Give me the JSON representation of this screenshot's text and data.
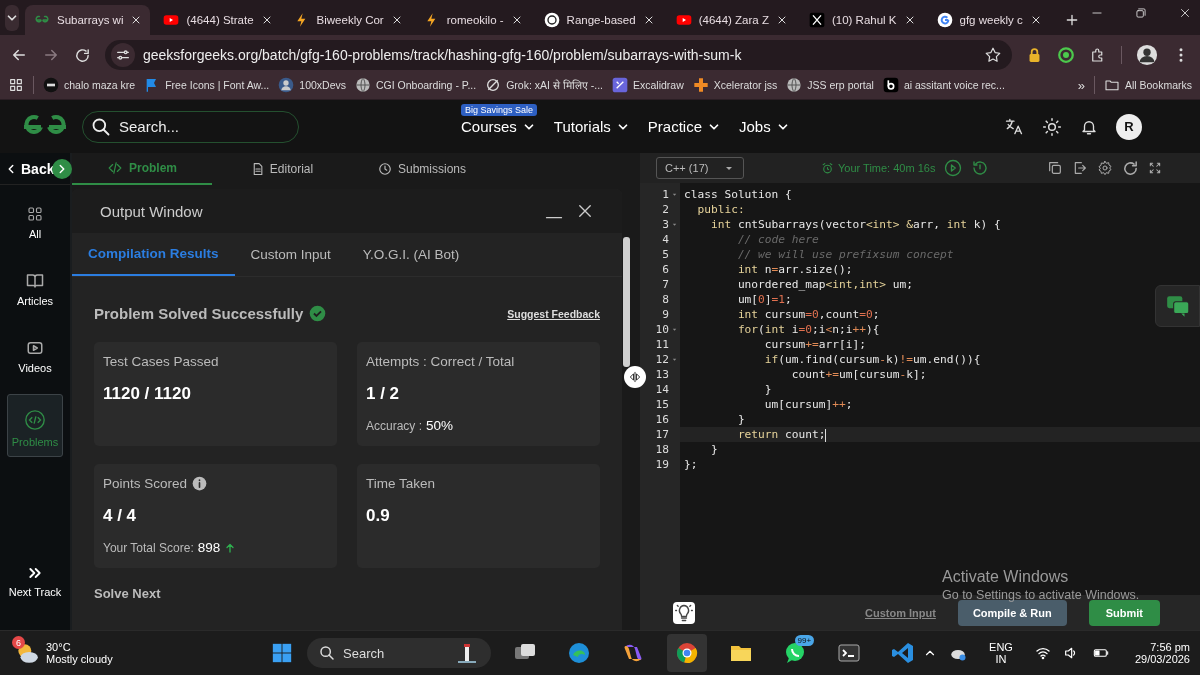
{
  "browser": {
    "tabs": [
      {
        "kind": "gfg",
        "label": "Subarrays wi",
        "selected": true
      },
      {
        "kind": "youtube",
        "label": "(4644) Strate",
        "selected": false
      },
      {
        "kind": "bolt",
        "label": "Biweekly Cor",
        "selected": false
      },
      {
        "kind": "bolt",
        "label": "romeokilo -",
        "selected": false
      },
      {
        "kind": "openai",
        "label": "Range-based",
        "selected": false
      },
      {
        "kind": "youtube",
        "label": "(4644) Zara Z",
        "selected": false
      },
      {
        "kind": "x",
        "label": "(10) Rahul K",
        "selected": false
      },
      {
        "kind": "google",
        "label": "gfg weekly c",
        "selected": false
      }
    ],
    "url": "geeksforgeeks.org/batch/gfg-160-problems/track/hashing-gfg-160/problem/subarrays-with-sum-k",
    "bookmarks": [
      {
        "kind": "tuf",
        "label": "chalo maza kre"
      },
      {
        "kind": "flag",
        "label": "Free Icons | Font Aw..."
      },
      {
        "kind": "avatar",
        "label": "100xDevs"
      },
      {
        "kind": "globe",
        "label": "CGI Onboarding - P..."
      },
      {
        "kind": "grok",
        "label": "Grok: xAI से मिलिए -..."
      },
      {
        "kind": "excalidraw",
        "label": "Excalidraw"
      },
      {
        "kind": "xcelerator",
        "label": "Xcelerator jss"
      },
      {
        "kind": "globe",
        "label": "JSS erp portal"
      },
      {
        "kind": "b",
        "label": "ai assitant voice rec..."
      }
    ],
    "more": "»",
    "all_bookmarks": "All Bookmarks"
  },
  "header": {
    "search_placeholder": "Search...",
    "promo": "Big Savings Sale",
    "nav": [
      "Courses",
      "Tutorials",
      "Practice",
      "Jobs"
    ],
    "avatar": "R"
  },
  "sidebar": {
    "back": "Back",
    "items": [
      {
        "kind": "grid",
        "label": "All",
        "selected": false
      },
      {
        "kind": "book",
        "label": "Articles",
        "selected": false
      },
      {
        "kind": "video",
        "label": "Videos",
        "selected": false
      },
      {
        "kind": "code",
        "label": "Problems",
        "selected": true
      }
    ],
    "next": "Next Track"
  },
  "problem_tabs": [
    {
      "kind": "code",
      "label": "Problem",
      "selected": true
    },
    {
      "kind": "doc",
      "label": "Editorial",
      "selected": false
    },
    {
      "kind": "clock",
      "label": "Submissions",
      "selected": false
    }
  ],
  "output": {
    "title": "Output Window",
    "tabs": [
      {
        "label": "Compilation Results",
        "selected": true
      },
      {
        "label": "Custom Input",
        "selected": false
      },
      {
        "label": "Y.O.G.I. (AI Bot)",
        "selected": false
      }
    ],
    "status": "Problem Solved Successfully",
    "feedback": "Suggest Feedback",
    "cards": [
      {
        "label": "Test Cases Passed",
        "value": "1120 / 1120"
      },
      {
        "label": "Attempts : Correct / Total",
        "value": "1 / 2",
        "note_label": "Accuracy :",
        "note_value": "50%"
      },
      {
        "label": "Points Scored",
        "info": true,
        "value": "4 / 4",
        "note_label": "Your Total Score:",
        "note_value": "898",
        "rising": true
      },
      {
        "label": "Time Taken",
        "value": "0.9"
      }
    ],
    "solve_next": "Solve Next"
  },
  "editor": {
    "language": "C++ (17)",
    "timer": "Your Time: 40m 16s",
    "lines": [
      {
        "n": "1",
        "fold": true,
        "current": false,
        "tokens": [
          {
            "text": "class Solution {",
            "kind": "plain"
          }
        ]
      },
      {
        "n": "2",
        "fold": false,
        "current": false,
        "tokens": [
          {
            "text": "  public:",
            "kind": "keyword"
          }
        ]
      },
      {
        "n": "3",
        "fold": true,
        "current": false,
        "tokens": [
          {
            "text": "    int",
            "kind": "keyword"
          },
          {
            "text": " cntSubarrays(vector",
            "kind": "plain"
          },
          {
            "text": "<int> &",
            "kind": "keyword"
          },
          {
            "text": "arr, ",
            "kind": "plain"
          },
          {
            "text": "int",
            "kind": "keyword"
          },
          {
            "text": " k) {",
            "kind": "plain"
          }
        ]
      },
      {
        "n": "4",
        "fold": false,
        "current": false,
        "tokens": [
          {
            "text": "        // code here",
            "kind": "comment"
          }
        ]
      },
      {
        "n": "5",
        "fold": false,
        "current": false,
        "tokens": [
          {
            "text": "        // we will use prefixsum concept",
            "kind": "comment"
          }
        ]
      },
      {
        "n": "6",
        "fold": false,
        "current": false,
        "tokens": [
          {
            "text": "        int",
            "kind": "keyword"
          },
          {
            "text": " n",
            "kind": "plain"
          },
          {
            "text": "=",
            "kind": "operator"
          },
          {
            "text": "arr.size();",
            "kind": "plain"
          }
        ]
      },
      {
        "n": "7",
        "fold": false,
        "current": false,
        "tokens": [
          {
            "text": "        unordered_map",
            "kind": "plain"
          },
          {
            "text": "<int,int>",
            "kind": "keyword"
          },
          {
            "text": " um;",
            "kind": "plain"
          }
        ]
      },
      {
        "n": "8",
        "fold": false,
        "current": false,
        "tokens": [
          {
            "text": "        um[",
            "kind": "plain"
          },
          {
            "text": "0",
            "kind": "number"
          },
          {
            "text": "]",
            "kind": "plain"
          },
          {
            "text": "=1",
            "kind": "number"
          },
          {
            "text": ";",
            "kind": "plain"
          }
        ]
      },
      {
        "n": "9",
        "fold": false,
        "current": false,
        "tokens": [
          {
            "text": "        int",
            "kind": "keyword"
          },
          {
            "text": " cursum",
            "kind": "plain"
          },
          {
            "text": "=0",
            "kind": "number"
          },
          {
            "text": ",count",
            "kind": "plain"
          },
          {
            "text": "=0",
            "kind": "number"
          },
          {
            "text": ";",
            "kind": "plain"
          }
        ]
      },
      {
        "n": "10",
        "fold": true,
        "current": false,
        "tokens": [
          {
            "text": "        for",
            "kind": "keyword"
          },
          {
            "text": "(",
            "kind": "plain"
          },
          {
            "text": "int",
            "kind": "keyword"
          },
          {
            "text": " i",
            "kind": "plain"
          },
          {
            "text": "=0",
            "kind": "number"
          },
          {
            "text": ";i",
            "kind": "plain"
          },
          {
            "text": "<",
            "kind": "operator"
          },
          {
            "text": "n;i",
            "kind": "plain"
          },
          {
            "text": "++",
            "kind": "operator"
          },
          {
            "text": "){",
            "kind": "plain"
          }
        ]
      },
      {
        "n": "11",
        "fold": false,
        "current": false,
        "tokens": [
          {
            "text": "            cursum",
            "kind": "plain"
          },
          {
            "text": "+=",
            "kind": "operator"
          },
          {
            "text": "arr[i];",
            "kind": "plain"
          }
        ]
      },
      {
        "n": "12",
        "fold": true,
        "current": false,
        "tokens": [
          {
            "text": "            if",
            "kind": "keyword"
          },
          {
            "text": "(um.find(cursum",
            "kind": "plain"
          },
          {
            "text": "-",
            "kind": "operator"
          },
          {
            "text": "k)",
            "kind": "plain"
          },
          {
            "text": "!=",
            "kind": "operator"
          },
          {
            "text": "um.end()){",
            "kind": "plain"
          }
        ]
      },
      {
        "n": "13",
        "fold": false,
        "current": false,
        "tokens": [
          {
            "text": "                count",
            "kind": "plain"
          },
          {
            "text": "+=",
            "kind": "operator"
          },
          {
            "text": "um[cursum",
            "kind": "plain"
          },
          {
            "text": "-",
            "kind": "operator"
          },
          {
            "text": "k];",
            "kind": "plain"
          }
        ]
      },
      {
        "n": "14",
        "fold": false,
        "current": false,
        "tokens": [
          {
            "text": "            }",
            "kind": "plain"
          }
        ]
      },
      {
        "n": "15",
        "fold": false,
        "current": false,
        "tokens": [
          {
            "text": "            um[cursum]",
            "kind": "plain"
          },
          {
            "text": "++",
            "kind": "operator"
          },
          {
            "text": ";",
            "kind": "plain"
          }
        ]
      },
      {
        "n": "16",
        "fold": false,
        "current": false,
        "tokens": [
          {
            "text": "        }",
            "kind": "plain"
          }
        ]
      },
      {
        "n": "17",
        "fold": false,
        "current": true,
        "tokens": [
          {
            "text": "        return",
            "kind": "keyword"
          },
          {
            "text": " count;",
            "kind": "plain"
          }
        ]
      },
      {
        "n": "18",
        "fold": false,
        "current": false,
        "tokens": [
          {
            "text": "    }",
            "kind": "plain"
          }
        ]
      },
      {
        "n": "19",
        "fold": false,
        "current": false,
        "tokens": [
          {
            "text": "};",
            "kind": "plain"
          }
        ]
      }
    ],
    "custom_input": "Custom Input",
    "compile": "Compile & Run",
    "submit": "Submit"
  },
  "os_notice": {
    "title": "Activate Windows",
    "text": "Go to Settings to activate Windows."
  },
  "taskbar": {
    "weather": {
      "badge": "6",
      "temp": "30°C",
      "text": "Mostly cloudy"
    },
    "search": "Search",
    "apps": [
      {
        "kind": "taskview",
        "selected": false
      },
      {
        "kind": "edge",
        "selected": false
      },
      {
        "kind": "copilot",
        "selected": false
      },
      {
        "kind": "chrome",
        "selected": true
      },
      {
        "kind": "folder",
        "selected": false
      },
      {
        "kind": "whatsapp",
        "badge": "99+",
        "selected": false
      },
      {
        "kind": "terminal",
        "selected": false
      },
      {
        "kind": "vscode",
        "selected": false
      }
    ],
    "lang": "ENG",
    "region": "IN",
    "time": "7:56 pm",
    "date": "29/03/2026"
  }
}
